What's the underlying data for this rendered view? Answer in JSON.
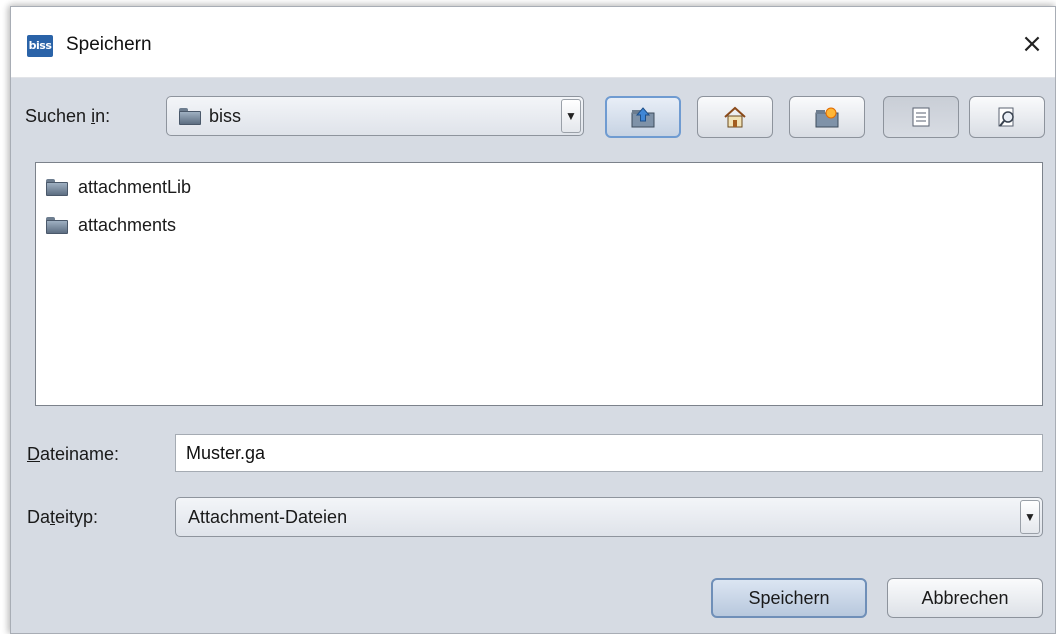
{
  "window": {
    "title": "Speichern",
    "app_icon_text": "biss",
    "close_glyph": "×"
  },
  "toolbar": {
    "look_in_prefix": "Suchen ",
    "look_in_underlined": "i",
    "look_in_suffix": "n:",
    "current_folder": "biss",
    "buttons": [
      {
        "icon": "up-one-level-icon"
      },
      {
        "icon": "home-icon"
      },
      {
        "icon": "new-folder-icon"
      },
      {
        "icon": "list-view-icon"
      },
      {
        "icon": "details-view-icon"
      }
    ]
  },
  "files": [
    {
      "name": "attachmentLib",
      "icon": "folder-icon"
    },
    {
      "name": "attachments",
      "icon": "folder-icon"
    }
  ],
  "filename": {
    "label_underlined": "D",
    "label_rest": "ateiname:",
    "value": "Muster.ga"
  },
  "filetype": {
    "label_prefix": "Da",
    "label_underlined": "t",
    "label_suffix": "eityp:",
    "selected": "Attachment-Dateien"
  },
  "actions": {
    "save_label": "Speichern",
    "cancel_label": "Abbrechen"
  },
  "dropdown_glyph": "▼",
  "colors": {
    "dialog_bg": "#d6dbe3",
    "app_icon_bg": "#2a63a8",
    "focus_border": "#6f9bd1"
  }
}
